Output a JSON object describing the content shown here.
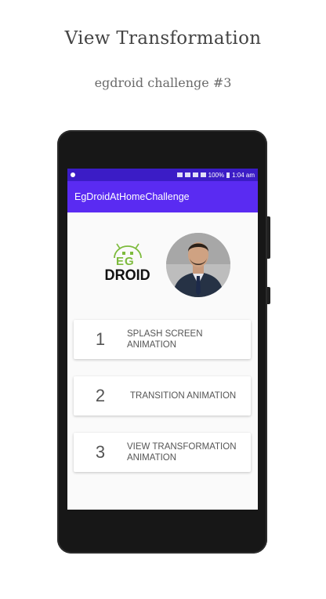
{
  "page": {
    "title": "View Transformation",
    "subtitle": "egdroid challenge #3"
  },
  "statusbar": {
    "battery": "100%",
    "time": "1:04 am"
  },
  "app": {
    "title": "EgDroidAtHomeChallenge",
    "primary_color": "#5a2bf2",
    "statusbar_color": "#3b1cc6"
  },
  "logo": {
    "top_text": "EG",
    "bottom_text": "DROID"
  },
  "cards": [
    {
      "number": "1",
      "label": "SPLASH SCREEN ANIMATION"
    },
    {
      "number": "2",
      "label": "TRANSITION ANIMATION"
    },
    {
      "number": "3",
      "label": "VIEW TRANSFORMATION ANIMATION"
    }
  ]
}
